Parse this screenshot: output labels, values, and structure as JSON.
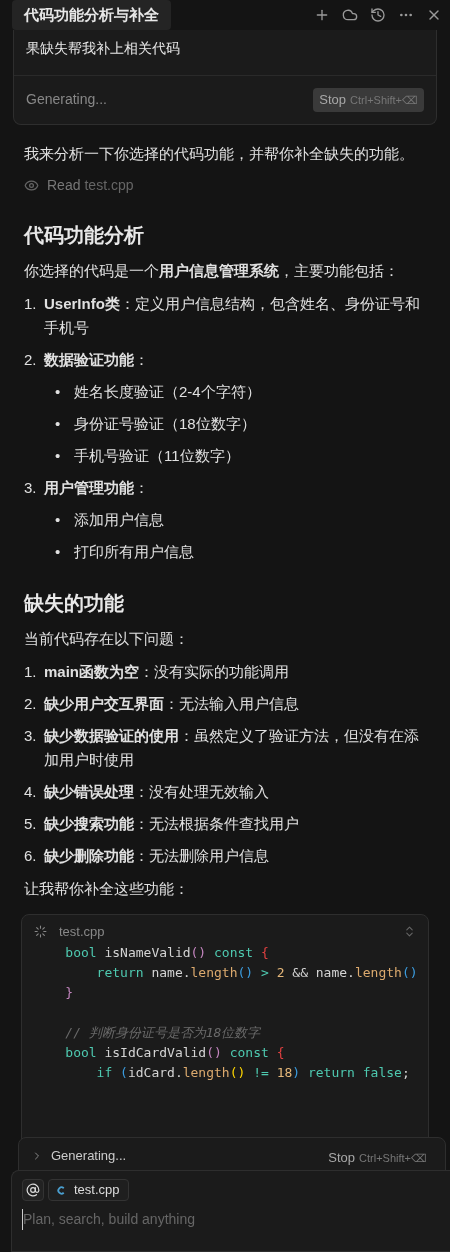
{
  "header": {
    "title": "代码功能分析与补全"
  },
  "prompt_box": {
    "text": "果缺失帮我补上相关代码",
    "status": "Generating...",
    "stop_label": "Stop",
    "stop_shortcut": "Ctrl+Shift+⌫"
  },
  "messages": [
    {
      "kind": "paragraph",
      "text": "我来分析一下你选择的代码功能，并帮你补全缺失的功能。"
    },
    {
      "kind": "tool",
      "verb": "Read",
      "file": "test.cpp"
    },
    {
      "kind": "heading",
      "text": "代码功能分析"
    },
    {
      "kind": "paragraph",
      "text": "你选择的代码是一个**用户信息管理系统**，主要功能包括："
    },
    {
      "kind": "list",
      "items": [
        {
          "marker": "1.",
          "text": "**UserInfo类**：定义用户信息结构，包含姓名、身份证号和手机号"
        },
        {
          "marker": "2.",
          "text": "**数据验证功能**：",
          "children": [
            {
              "marker": "•",
              "text": "姓名长度验证（2-4个字符）"
            },
            {
              "marker": "•",
              "text": "身份证号验证（18位数字）"
            },
            {
              "marker": "•",
              "text": "手机号验证（11位数字）"
            }
          ]
        },
        {
          "marker": "3.",
          "text": "**用户管理功能**：",
          "children": [
            {
              "marker": "•",
              "text": "添加用户信息"
            },
            {
              "marker": "•",
              "text": "打印所有用户信息"
            }
          ]
        }
      ]
    },
    {
      "kind": "heading",
      "text": "缺失的功能"
    },
    {
      "kind": "paragraph",
      "text": "当前代码存在以下问题："
    },
    {
      "kind": "list",
      "items": [
        {
          "marker": "1.",
          "text": "**main函数为空**：没有实际的功能调用"
        },
        {
          "marker": "2.",
          "text": "**缺少用户交互界面**：无法输入用户信息"
        },
        {
          "marker": "3.",
          "text": "**缺少数据验证的使用**：虽然定义了验证方法，但没有在添加用户时使用"
        },
        {
          "marker": "4.",
          "text": "**缺少错误处理**：没有处理无效输入"
        },
        {
          "marker": "5.",
          "text": "**缺少搜索功能**：无法根据条件查找用户"
        },
        {
          "marker": "6.",
          "text": "**缺少删除功能**：无法删除用户信息"
        }
      ]
    },
    {
      "kind": "paragraph",
      "text": "让我帮你补全这些功能："
    }
  ],
  "code_block": {
    "file": "test.cpp",
    "lines": [
      {
        "kind": "code",
        "tokens": [
          {
            "kind": "type",
            "text": "    bool"
          },
          {
            "kind": "plain",
            "text": " isNameValid"
          },
          {
            "kind": "paren",
            "text": "() "
          },
          {
            "kind": "type",
            "text": "const "
          },
          {
            "kind": "brace",
            "text": "{"
          }
        ]
      },
      {
        "kind": "code",
        "tokens": [
          {
            "kind": "type",
            "text": "        return"
          },
          {
            "kind": "plain",
            "text": " name."
          },
          {
            "kind": "func",
            "text": "length"
          },
          {
            "kind": "paren2",
            "text": "() "
          },
          {
            "kind": "type",
            "text": "> "
          },
          {
            "kind": "number",
            "text": "2"
          },
          {
            "kind": "plain",
            "text": " && name."
          },
          {
            "kind": "func",
            "text": "length"
          },
          {
            "kind": "paren2",
            "text": "()"
          }
        ]
      },
      {
        "kind": "code",
        "tokens": [
          {
            "kind": "paren",
            "text": "    }"
          }
        ]
      },
      {
        "kind": "blank"
      },
      {
        "kind": "code",
        "tokens": [
          {
            "kind": "comment",
            "text": "    // 判断身份证号是否为18位数字"
          }
        ]
      },
      {
        "kind": "code",
        "tokens": [
          {
            "kind": "type",
            "text": "    bool"
          },
          {
            "kind": "plain",
            "text": " isIdCardValid"
          },
          {
            "kind": "paren",
            "text": "() "
          },
          {
            "kind": "type",
            "text": "const "
          },
          {
            "kind": "brace",
            "text": "{"
          }
        ]
      },
      {
        "kind": "code",
        "tokens": [
          {
            "kind": "type",
            "text": "        if "
          },
          {
            "kind": "paren2",
            "text": "("
          },
          {
            "kind": "plain",
            "text": "idCard."
          },
          {
            "kind": "func",
            "text": "length"
          },
          {
            "kind": "paren3",
            "text": "() "
          },
          {
            "kind": "type",
            "text": "!= "
          },
          {
            "kind": "number",
            "text": "18"
          },
          {
            "kind": "paren2",
            "text": ") "
          },
          {
            "kind": "type",
            "text": "return false"
          },
          {
            "kind": "plain",
            "text": ";"
          }
        ]
      }
    ]
  },
  "generating_bar": {
    "status": "Generating...",
    "stop_label": "Stop",
    "stop_shortcut": "Ctrl+Shift+⌫"
  },
  "composer": {
    "context_file": "test.cpp",
    "placeholder": "Plan, search, build anything"
  }
}
